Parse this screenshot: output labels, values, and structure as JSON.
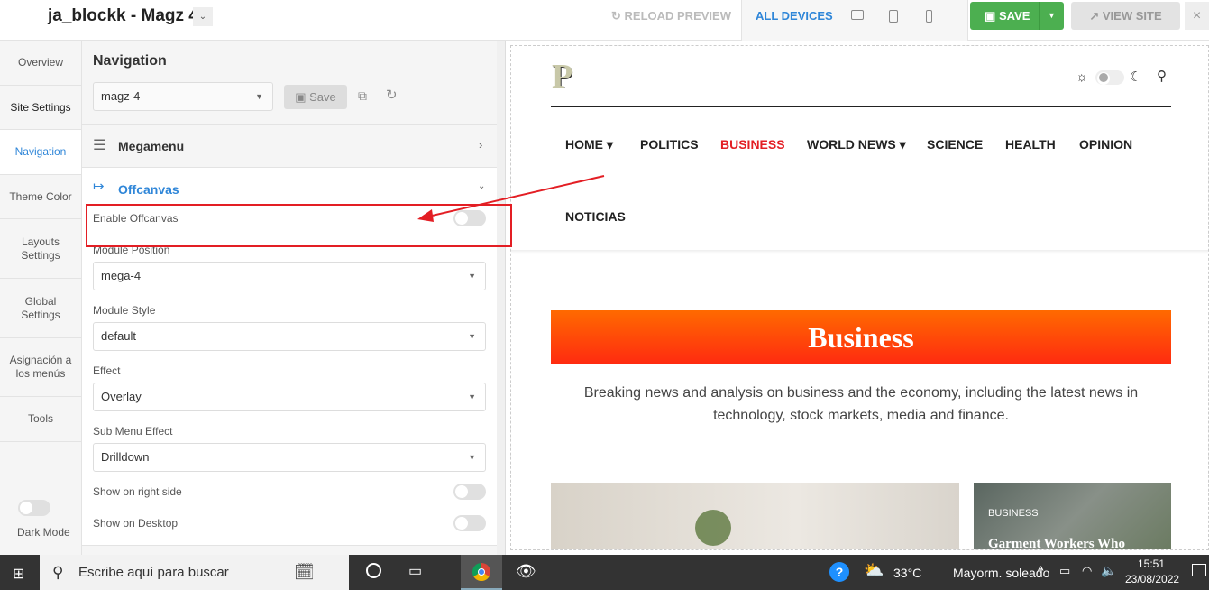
{
  "header": {
    "title": "ja_blockk - Magz 4",
    "reload": "RELOAD PREVIEW",
    "all_devices": "ALL DEVICES",
    "save": "SAVE",
    "view_site": "VIEW SITE",
    "close": "×"
  },
  "sidebar": {
    "items": [
      "Overview",
      "Site Settings",
      "Navigation",
      "Theme Color",
      "Layouts Settings",
      "Global Settings",
      "Asignación a los menús",
      "Tools"
    ],
    "active": "Navigation",
    "dark_mode": "Dark Mode"
  },
  "panel": {
    "title": "Navigation",
    "theme_select": "magz-4",
    "save": "Save",
    "megamenu": "Megamenu",
    "offcanvas": "Offcanvas",
    "fields": {
      "enable_offcanvas": "Enable Offcanvas",
      "module_position_label": "Module Position",
      "module_position": "mega-4",
      "module_style_label": "Module Style",
      "module_style": "default",
      "effect_label": "Effect",
      "effect": "Overlay",
      "sub_menu_label": "Sub Menu Effect",
      "sub_menu": "Drilldown",
      "right_side": "Show on right side",
      "desktop": "Show on Desktop"
    },
    "toggles": {
      "enable_offcanvas": false,
      "right_side": false,
      "desktop": false,
      "dark_mode": false
    }
  },
  "preview": {
    "logo": "P",
    "nav": [
      "HOME",
      "POLITICS",
      "BUSINESS",
      "WORLD NEWS",
      "SCIENCE",
      "HEALTH",
      "OPINION",
      "NOTICIAS"
    ],
    "active_nav": "BUSINESS",
    "banner": "Business",
    "description": "Breaking news and analysis on business and the economy, including the latest news in technology, stock markets, media and finance.",
    "card_tag": "BUSINESS",
    "card_title": "Garment Workers Who"
  },
  "taskbar": {
    "search": "Escribe aquí para buscar",
    "temp": "33°C",
    "weather": "Mayorm. soleado",
    "time": "15:51",
    "date": "23/08/2022"
  },
  "colors": {
    "accent": "#2f86d8",
    "save": "#4caf50",
    "highlight": "#e31e24",
    "banner": "#ff5a00"
  }
}
